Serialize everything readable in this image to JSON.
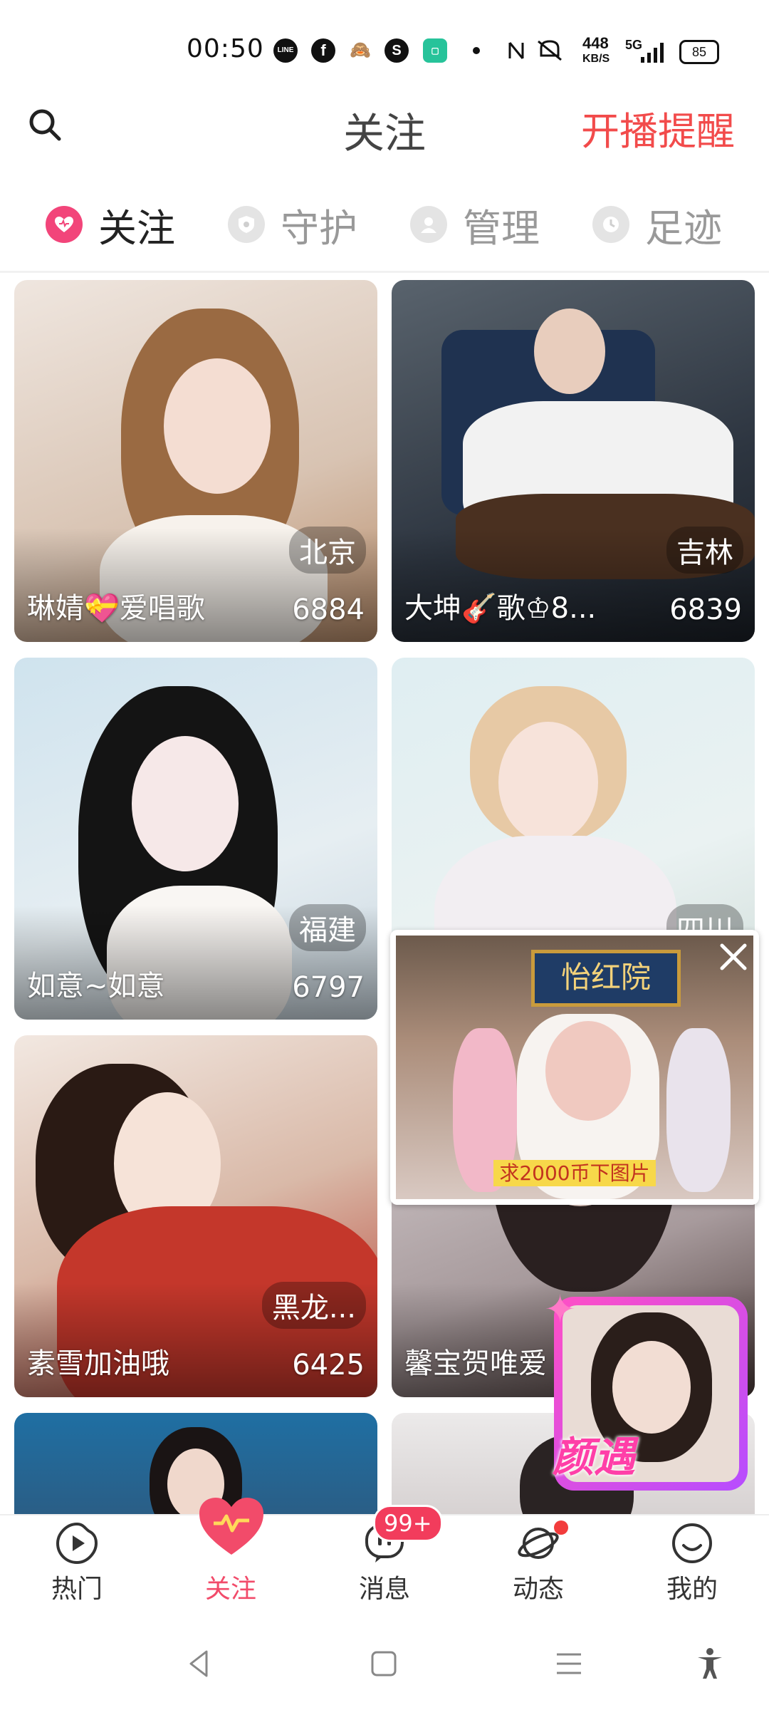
{
  "status_bar": {
    "time": "00:50",
    "app_icons": [
      "LINE",
      "f",
      "🙈",
      "S",
      "▢"
    ],
    "net_speed_top": "448",
    "net_speed_bottom": "KB/S",
    "network": "5G",
    "battery": "85"
  },
  "header": {
    "title": "关注",
    "right_link": "开播提醒"
  },
  "tabs": [
    {
      "label": "关注",
      "icon": "heart-icon",
      "active": true
    },
    {
      "label": "守护",
      "icon": "shield-icon",
      "active": false
    },
    {
      "label": "管理",
      "icon": "person-icon",
      "active": false
    },
    {
      "label": "足迹",
      "icon": "clock-icon",
      "active": false
    }
  ],
  "cards": [
    {
      "name": "琳婧💝爱唱歌",
      "count": "6884",
      "city": "北京"
    },
    {
      "name": "大坤🎸歌♔8...",
      "count": "6839",
      "city": "吉林"
    },
    {
      "name": "如意~如意",
      "count": "6797",
      "city": "福建"
    },
    {
      "name": "",
      "count": "",
      "city": "四川"
    },
    {
      "name": "素雪加油哦",
      "count": "6425",
      "city": "黑龙..."
    },
    {
      "name": "馨宝贺唯爱",
      "count": "",
      "city": ""
    }
  ],
  "floating_video": {
    "sign_text": "怡红院",
    "caption": "求2000币下图片"
  },
  "floating_badge": {
    "label": "颜遇"
  },
  "bottom_nav": [
    {
      "label": "热门",
      "icon": "play-icon"
    },
    {
      "label": "关注",
      "icon": "heart-icon"
    },
    {
      "label": "消息",
      "icon": "chat-icon"
    },
    {
      "label": "动态",
      "icon": "planet-icon"
    },
    {
      "label": "我的",
      "icon": "smile-icon"
    }
  ],
  "message_badge": "99+",
  "colors": {
    "accent": "#f24b4b",
    "active_nav": "#f24b6a",
    "badge": "#f23c5c"
  }
}
